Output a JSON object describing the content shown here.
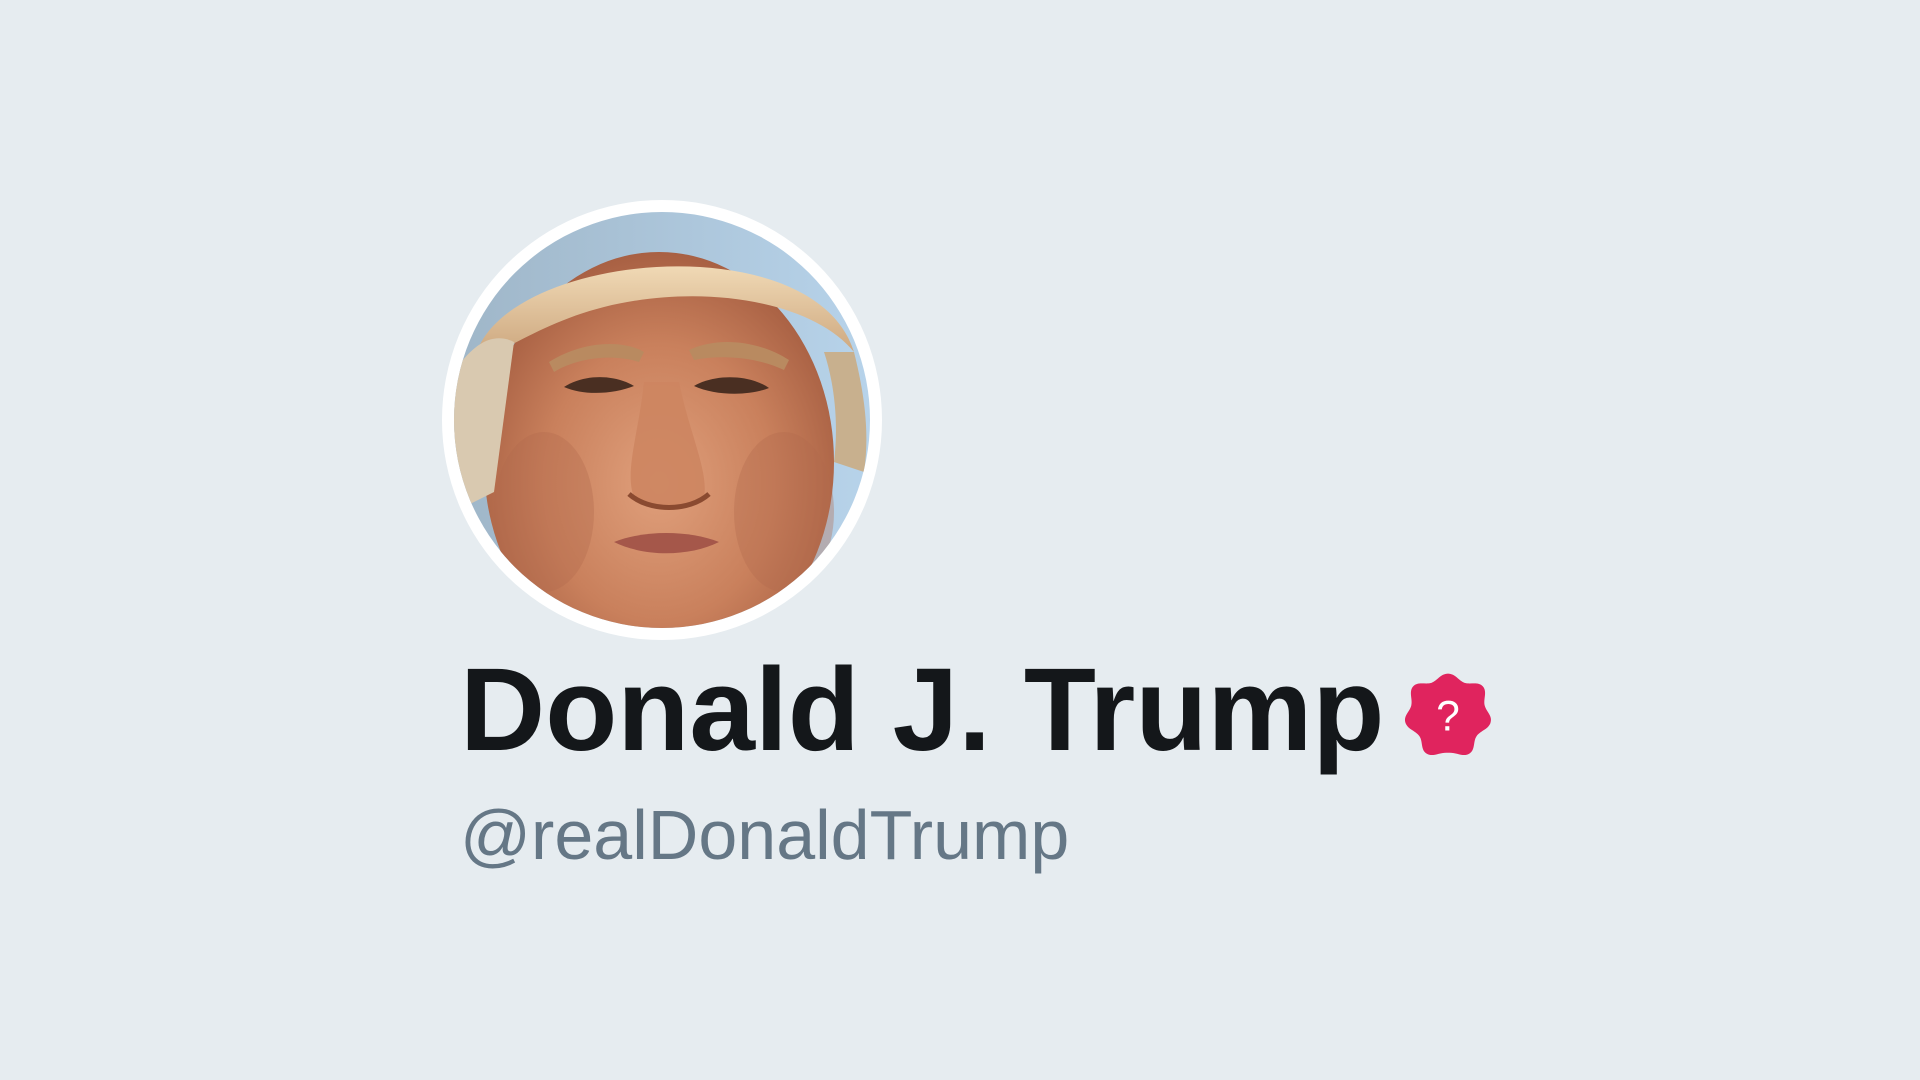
{
  "profile": {
    "display_name": "Donald J. Trump",
    "handle": "@realDonaldTrump",
    "avatar": "profile-photo",
    "badge": {
      "icon": "question-badge-icon",
      "glyph": "?",
      "color": "#e0245e"
    }
  },
  "colors": {
    "background": "#e6ecf0",
    "name_text": "#14171a",
    "handle_text": "#657786"
  }
}
